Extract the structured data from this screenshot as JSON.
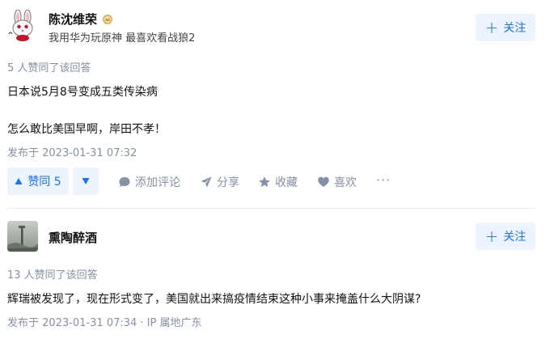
{
  "answers": [
    {
      "author": {
        "name": "陈沈维荣",
        "bio": "我用华为玩原神 最喜欢看战狼2"
      },
      "follow_label": "关注",
      "voters_text": "5 人赞同了该回答",
      "content": [
        "日本说5月8号变成五类传染病",
        "怎么敢比美国早啊，岸田不孝！"
      ],
      "timestamp": "发布于 2023-01-31 07:32",
      "actions": {
        "upvote_label": "赞同 5",
        "comment_label": "添加评论",
        "share_label": "分享",
        "favorite_label": "收藏",
        "like_label": "喜欢",
        "more_label": "···"
      }
    },
    {
      "author": {
        "name": "熏陶醉酒"
      },
      "follow_label": "关注",
      "voters_text": "13 人赞同了该回答",
      "content": [
        "辉瑞被发现了，现在形式变了，美国就出来搞疫情结束这种小事来掩盖什么大阴谋?"
      ],
      "timestamp": "发布于 2023-01-31 07:34 · IP 属地广东"
    }
  ],
  "colors": {
    "accent": "#1772f6",
    "accent_bg": "#eef4ff",
    "meta": "#8590a6"
  }
}
